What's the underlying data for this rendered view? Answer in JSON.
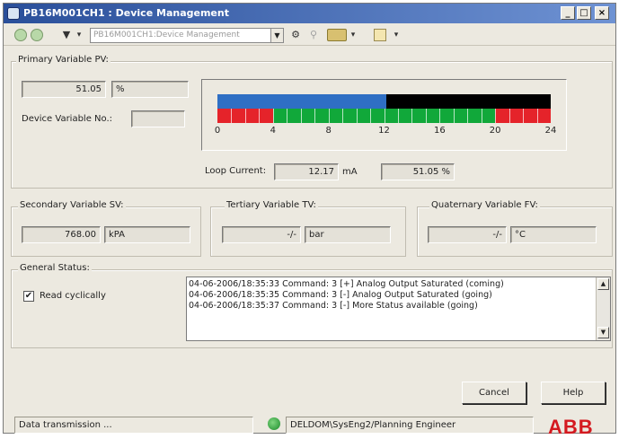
{
  "window": {
    "title": "PB16M001CH1 : Device Management",
    "minimize": "_",
    "maximize": "□",
    "close": "×"
  },
  "toolbar": {
    "back": "◀",
    "forward": "▶",
    "filter": "▼",
    "dropdown_arrow": "▾",
    "device_path": "PB16M001CH1:Device Management",
    "icons": [
      "back-icon",
      "forward-icon",
      "filter-icon",
      "settings-icon",
      "link-icon",
      "device-icon",
      "edit-icon"
    ]
  },
  "primary": {
    "label": "Primary Variable PV:",
    "value": "51.05",
    "unit": "%",
    "device_var_label": "Device Variable No.:",
    "device_var_value": "",
    "bar_scale": [
      "0",
      "4",
      "8",
      "12",
      "16",
      "20",
      "24"
    ],
    "bar_min": 0,
    "bar_max": 24,
    "bar_value": 12.17,
    "colors": {
      "fill": "#2f6fc4",
      "empty": "#000000",
      "alarm": "#e5232a",
      "ok": "#11a83a"
    },
    "loop_current_label": "Loop Current:",
    "loop_current": "12.17",
    "loop_unit": "mA",
    "percent": "51.05 %"
  },
  "secondary": {
    "label": "Secondary Variable SV:",
    "value": "768.00",
    "unit": "kPA"
  },
  "tertiary": {
    "label": "Tertiary Variable TV:",
    "value": "-/-",
    "unit": "bar"
  },
  "quaternary": {
    "label": "Quaternary Variable FV:",
    "value": "-/-",
    "unit": "°C"
  },
  "general": {
    "label": "General Status:",
    "read_cyclically": "Read cyclically",
    "checked": "✔",
    "log": [
      "04-06-2006/18:35:33 Command: 3 [+] Analog Output Saturated (coming)",
      "04-06-2006/18:35:35 Command: 3 [-] Analog Output Saturated (going)",
      "04-06-2006/18:35:37 Command: 3 [-] More Status available (going)"
    ],
    "scroll_up": "▲",
    "scroll_down": "▼"
  },
  "buttons": {
    "cancel": "Cancel",
    "help": "Help"
  },
  "statusbar": {
    "message": "Data transmission ...",
    "user": "DELDOM\\SysEng2/Planning Engineer",
    "brand": "ABB"
  }
}
